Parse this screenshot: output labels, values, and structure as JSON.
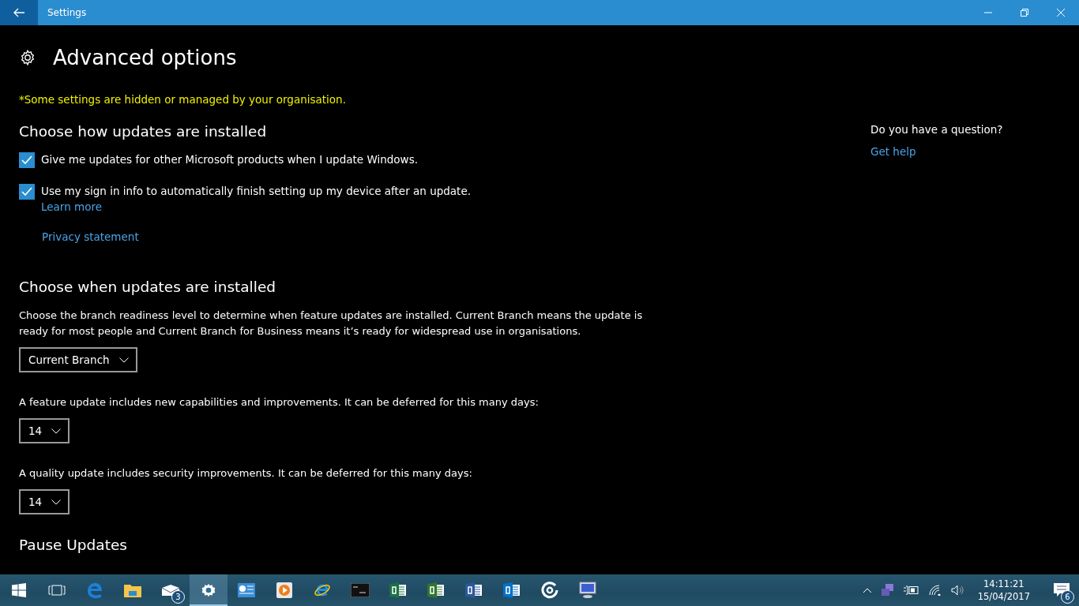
{
  "window": {
    "title": "Settings"
  },
  "page": {
    "title": "Advanced options",
    "notice": "*Some settings are hidden or managed by your organisation."
  },
  "sections": [
    {
      "heading": "Choose how updates are installed",
      "items": [
        {
          "kind": "checkbox",
          "label": "Give me updates for other Microsoft products when I update Windows.",
          "checked": true
        },
        {
          "kind": "checkbox",
          "label": "Use my sign in info to automatically finish setting up my device after an update.",
          "checked": true,
          "link": "Learn more"
        },
        {
          "kind": "link",
          "label": "Privacy statement"
        }
      ]
    },
    {
      "heading": "Choose when updates are installed",
      "items": [
        {
          "kind": "text",
          "label": "Choose the branch readiness level to determine when feature updates are installed. Current Branch means the update is ready for most people and Current Branch for Business means it’s ready for widespread use in organisations."
        },
        {
          "kind": "dropdown",
          "value": "Current Branch"
        },
        {
          "kind": "text",
          "label": "A feature update includes new capabilities and improvements. It can be deferred for this many days:"
        },
        {
          "kind": "dropdown",
          "value": "14"
        },
        {
          "kind": "text",
          "label": "A quality update includes security improvements. It can be deferred for this many days:"
        },
        {
          "kind": "dropdown",
          "value": "14"
        }
      ]
    },
    {
      "heading": "Pause Updates"
    }
  ],
  "help": {
    "question": "Do you have a question?",
    "link": "Get help"
  },
  "taskbar": {
    "apps": [
      {
        "kind": "start",
        "selected": false
      },
      {
        "kind": "taskview",
        "selected": false
      },
      {
        "kind": "edge",
        "selected": false
      },
      {
        "kind": "folder",
        "selected": false
      },
      {
        "kind": "mail",
        "selected": false,
        "badge": "3"
      },
      {
        "kind": "settings",
        "selected": true
      },
      {
        "kind": "panel",
        "selected": false
      },
      {
        "kind": "media",
        "selected": false
      },
      {
        "kind": "ie",
        "selected": false
      },
      {
        "kind": "console",
        "selected": false
      },
      {
        "kind": "excel",
        "selected": false
      },
      {
        "kind": "project",
        "selected": false
      },
      {
        "kind": "word",
        "selected": false
      },
      {
        "kind": "outlook",
        "selected": false
      },
      {
        "kind": "ring",
        "selected": false
      },
      {
        "kind": "monitor",
        "selected": false
      }
    ],
    "time": "14:11:21",
    "date": "15/04/2017",
    "notifications": "6"
  }
}
